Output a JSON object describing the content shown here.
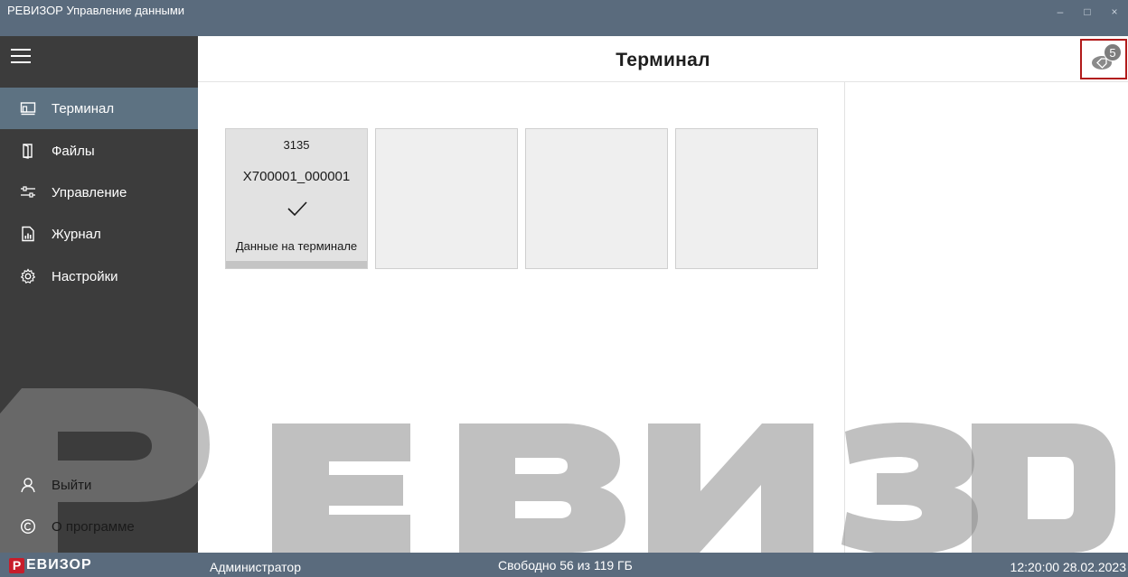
{
  "window": {
    "title": "РЕВИЗОР Управление данными",
    "controls": [
      "–",
      "□",
      "×"
    ]
  },
  "sidebar": {
    "menu_icon": "hamburger-icon",
    "items": [
      {
        "label": "Терминал",
        "icon": "terminal-icon",
        "active": true
      },
      {
        "label": "Файлы",
        "icon": "files-icon",
        "active": false
      },
      {
        "label": "Управление",
        "icon": "sliders-icon",
        "active": false
      },
      {
        "label": "Журнал",
        "icon": "journal-icon",
        "active": false
      },
      {
        "label": "Настройки",
        "icon": "gear-icon",
        "active": false
      }
    ],
    "bottom_items": [
      {
        "label": "Выйти",
        "icon": "user-icon"
      },
      {
        "label": "О программе",
        "icon": "copyright-icon"
      }
    ]
  },
  "header": {
    "title": "Терминал",
    "badge_icon": "tag-icon",
    "badge_count": "5"
  },
  "terminal_cards": [
    {
      "number": "3135",
      "name": "X700001_000001",
      "status_icon": "check-icon",
      "status": "Данные на терминале"
    },
    {
      "number": "",
      "name": "",
      "status": ""
    },
    {
      "number": "",
      "name": "",
      "status": ""
    },
    {
      "number": "",
      "name": "",
      "status": ""
    }
  ],
  "watermark": {
    "text": "РЕВИЗОР"
  },
  "statusbar": {
    "logo_letter": "Р",
    "logo_text": "ЕВИЗОР",
    "user": "Администратор",
    "disk": "Свободно 56 из 119 ГБ",
    "datetime": "12:20:00 28.02.2023"
  },
  "colors": {
    "titlebar": "#5a6b7d",
    "sidebar": "#3c3c3c",
    "active_item": "#5d7282",
    "highlight_border": "#b21a1a",
    "logo": "#c81d2b"
  }
}
